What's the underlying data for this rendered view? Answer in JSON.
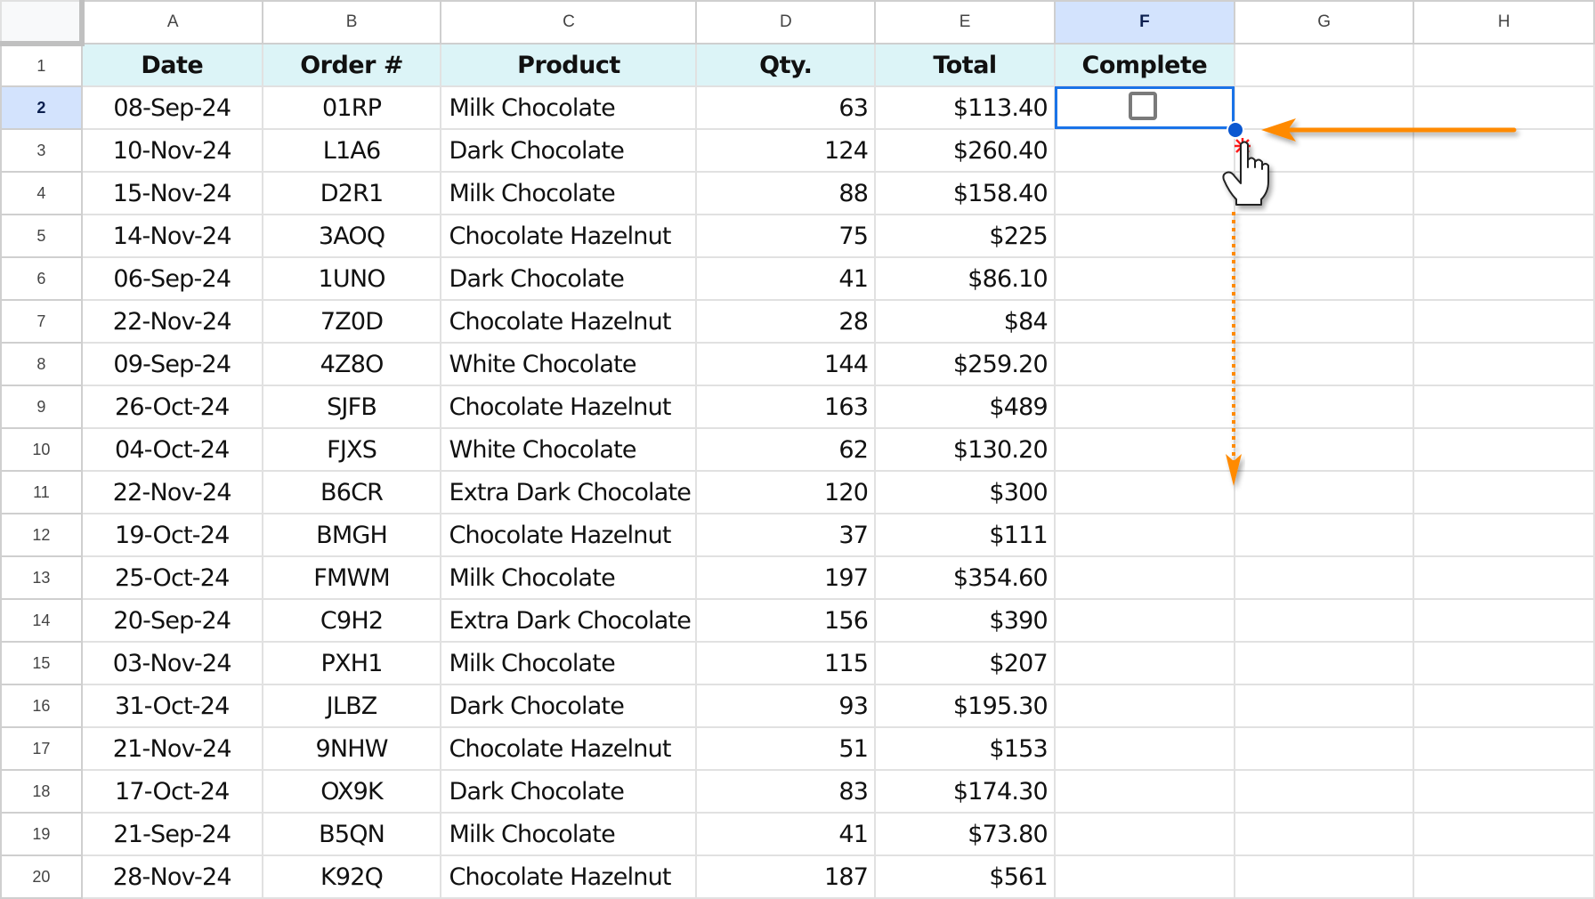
{
  "column_headers": [
    "A",
    "B",
    "C",
    "D",
    "E",
    "F",
    "G",
    "H"
  ],
  "selected_column": "F",
  "selected_row": "2",
  "selected_cell": "F2",
  "colors": {
    "header_fill": "#dcf4f7",
    "selection_border": "#1a73e8",
    "selection_header_fill": "#d3e3fd",
    "annotation_arrow": "#ff8a00"
  },
  "table": {
    "headers": [
      "Date",
      "Order #",
      "Product",
      "Qty.",
      "Total",
      "Complete"
    ],
    "rows": [
      {
        "row": "2",
        "date": "08-Sep-24",
        "order": "01RP",
        "product": "Milk Chocolate",
        "qty": "63",
        "total": "$113.40"
      },
      {
        "row": "3",
        "date": "10-Nov-24",
        "order": "L1A6",
        "product": "Dark Chocolate",
        "qty": "124",
        "total": "$260.40"
      },
      {
        "row": "4",
        "date": "15-Nov-24",
        "order": "D2R1",
        "product": "Milk Chocolate",
        "qty": "88",
        "total": "$158.40"
      },
      {
        "row": "5",
        "date": "14-Nov-24",
        "order": "3AOQ",
        "product": "Chocolate Hazelnut",
        "qty": "75",
        "total": "$225"
      },
      {
        "row": "6",
        "date": "06-Sep-24",
        "order": "1UNO",
        "product": "Dark Chocolate",
        "qty": "41",
        "total": "$86.10"
      },
      {
        "row": "7",
        "date": "22-Nov-24",
        "order": "7Z0D",
        "product": "Chocolate Hazelnut",
        "qty": "28",
        "total": "$84"
      },
      {
        "row": "8",
        "date": "09-Sep-24",
        "order": "4Z8O",
        "product": "White Chocolate",
        "qty": "144",
        "total": "$259.20"
      },
      {
        "row": "9",
        "date": "26-Oct-24",
        "order": "SJFB",
        "product": "Chocolate Hazelnut",
        "qty": "163",
        "total": "$489"
      },
      {
        "row": "10",
        "date": "04-Oct-24",
        "order": "FJXS",
        "product": "White Chocolate",
        "qty": "62",
        "total": "$130.20"
      },
      {
        "row": "11",
        "date": "22-Nov-24",
        "order": "B6CR",
        "product": "Extra Dark Chocolate",
        "qty": "120",
        "total": "$300"
      },
      {
        "row": "12",
        "date": "19-Oct-24",
        "order": "BMGH",
        "product": "Chocolate Hazelnut",
        "qty": "37",
        "total": "$111"
      },
      {
        "row": "13",
        "date": "25-Oct-24",
        "order": "FMWM",
        "product": "Milk Chocolate",
        "qty": "197",
        "total": "$354.60"
      },
      {
        "row": "14",
        "date": "20-Sep-24",
        "order": "C9H2",
        "product": "Extra Dark Chocolate",
        "qty": "156",
        "total": "$390"
      },
      {
        "row": "15",
        "date": "03-Nov-24",
        "order": "PXH1",
        "product": "Milk Chocolate",
        "qty": "115",
        "total": "$207"
      },
      {
        "row": "16",
        "date": "31-Oct-24",
        "order": "JLBZ",
        "product": "Dark Chocolate",
        "qty": "93",
        "total": "$195.30"
      },
      {
        "row": "17",
        "date": "21-Nov-24",
        "order": "9NHW",
        "product": "Chocolate Hazelnut",
        "qty": "51",
        "total": "$153"
      },
      {
        "row": "18",
        "date": "17-Oct-24",
        "order": "OX9K",
        "product": "Dark Chocolate",
        "qty": "83",
        "total": "$174.30"
      },
      {
        "row": "19",
        "date": "21-Sep-24",
        "order": "B5QN",
        "product": "Milk Chocolate",
        "qty": "41",
        "total": "$73.80"
      },
      {
        "row": "20",
        "date": "28-Nov-24",
        "order": "K92Q",
        "product": "Chocolate Hazelnut",
        "qty": "187",
        "total": "$561"
      }
    ]
  },
  "complete_checkbox": {
    "checked": false
  },
  "annotations": {
    "arrow_to_fill_handle": "pointing-left-arrow",
    "drag_down_arrow": "dotted-down-arrow",
    "cursor": "hand-pointer-cursor"
  }
}
